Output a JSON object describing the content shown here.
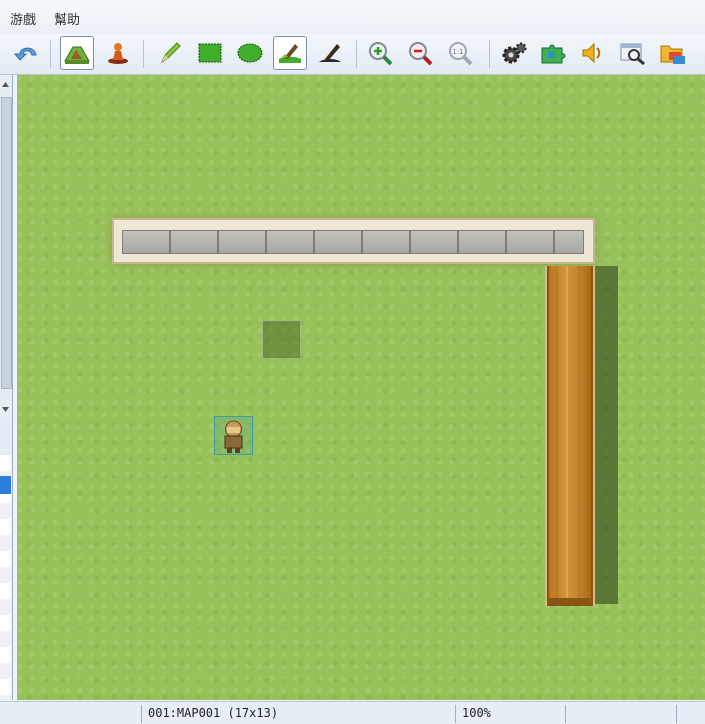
{
  "menu": {
    "game_label": "游戲",
    "help_label": "幫助"
  },
  "toolbar": {
    "buttons": [
      {
        "name": "undo-button",
        "icon": "undo-arrow-icon"
      },
      {
        "name": "map-mode-button",
        "icon": "map-tiles-icon",
        "active": true
      },
      {
        "name": "event-mode-button",
        "icon": "event-pawn-icon"
      },
      {
        "name": "pencil-tool-button",
        "icon": "pencil-icon"
      },
      {
        "name": "rectangle-tool-button",
        "icon": "rectangle-icon"
      },
      {
        "name": "ellipse-tool-button",
        "icon": "ellipse-icon"
      },
      {
        "name": "fill-tool-button",
        "icon": "paint-bucket-icon",
        "active": true
      },
      {
        "name": "shadow-pen-button",
        "icon": "shadow-pen-icon"
      },
      {
        "name": "zoom-in-button",
        "icon": "zoom-in-icon"
      },
      {
        "name": "zoom-out-button",
        "icon": "zoom-out-icon"
      },
      {
        "name": "zoom-actual-button",
        "icon": "zoom-1to1-icon"
      },
      {
        "name": "database-button",
        "icon": "gears-icon"
      },
      {
        "name": "plugin-manager-button",
        "icon": "puzzle-icon"
      },
      {
        "name": "sound-test-button",
        "icon": "speaker-icon"
      },
      {
        "name": "event-search-button",
        "icon": "search-window-icon"
      },
      {
        "name": "resource-manager-button",
        "icon": "folders-icon"
      }
    ],
    "zoom_actual_label": "1:1"
  },
  "map": {
    "ground": "grass",
    "wall_segments": 10,
    "colors": {
      "grass": "#97c25a",
      "wall_frame": "#efe7d6",
      "stone": "#b3b1ac",
      "wood": "#c4852d"
    }
  },
  "status": {
    "map_info": "001:MAP001 (17x13)",
    "zoom": "100%"
  }
}
